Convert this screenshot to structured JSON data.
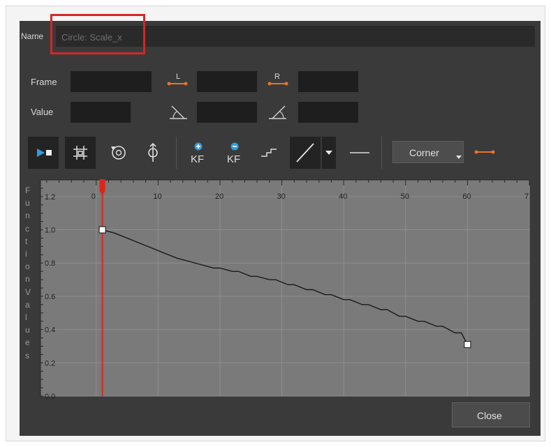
{
  "dialog": {
    "name_label": "Name",
    "name_value": "Circle: Scale_x",
    "frame_label": "Frame",
    "value_label": "Value",
    "left_handle_letter": "L",
    "right_handle_letter": "R",
    "kf_add_label": "KF",
    "kf_remove_label": "KF",
    "interpolation_select": "Corner",
    "close_label": "Close"
  },
  "colors": {
    "dialog_bg": "#3a3a3a",
    "graph_bg": "#7a7a7a",
    "accent_orange": "#e8742a",
    "accent_blue": "#2e9de0",
    "playhead": "#e0241b",
    "highlight_box": "#d32727"
  },
  "icons": [
    "play-icon",
    "frame-grid-icon",
    "cycle-icon",
    "align-icon",
    "add-keyframe-icon",
    "remove-keyframe-icon",
    "stepped-icon",
    "linear-icon",
    "dropdown-icon",
    "flat-icon",
    "handle-icon"
  ],
  "chart_data": {
    "type": "line",
    "ylabel": "Function Values",
    "x_ticks": [
      "0",
      "10",
      "20",
      "30",
      "40",
      "50",
      "60",
      "7"
    ],
    "y_ticks": [
      "0.0",
      "0.2",
      "0.4",
      "0.6",
      "0.8",
      "1.0",
      "1.2"
    ],
    "xlim": [
      -9,
      70
    ],
    "ylim": [
      0,
      1.3
    ],
    "playhead_frame": 1,
    "keyframes": [
      {
        "x": 1,
        "y": 1.0
      },
      {
        "x": 60,
        "y": 0.31
      }
    ],
    "series": [
      {
        "x": [
          1,
          3,
          5,
          7,
          9,
          11,
          13,
          15,
          17,
          19,
          20,
          22,
          23,
          25,
          26,
          28,
          29,
          31,
          32,
          34,
          35,
          37,
          38,
          40,
          41,
          43,
          44,
          46,
          47,
          49,
          50,
          52,
          53,
          55,
          56,
          58,
          59,
          60
        ],
        "y": [
          1.0,
          0.98,
          0.95,
          0.92,
          0.89,
          0.86,
          0.83,
          0.81,
          0.79,
          0.77,
          0.77,
          0.75,
          0.75,
          0.72,
          0.72,
          0.7,
          0.7,
          0.67,
          0.67,
          0.64,
          0.64,
          0.61,
          0.61,
          0.58,
          0.58,
          0.55,
          0.55,
          0.52,
          0.52,
          0.48,
          0.48,
          0.45,
          0.45,
          0.42,
          0.42,
          0.38,
          0.38,
          0.31
        ]
      }
    ]
  }
}
